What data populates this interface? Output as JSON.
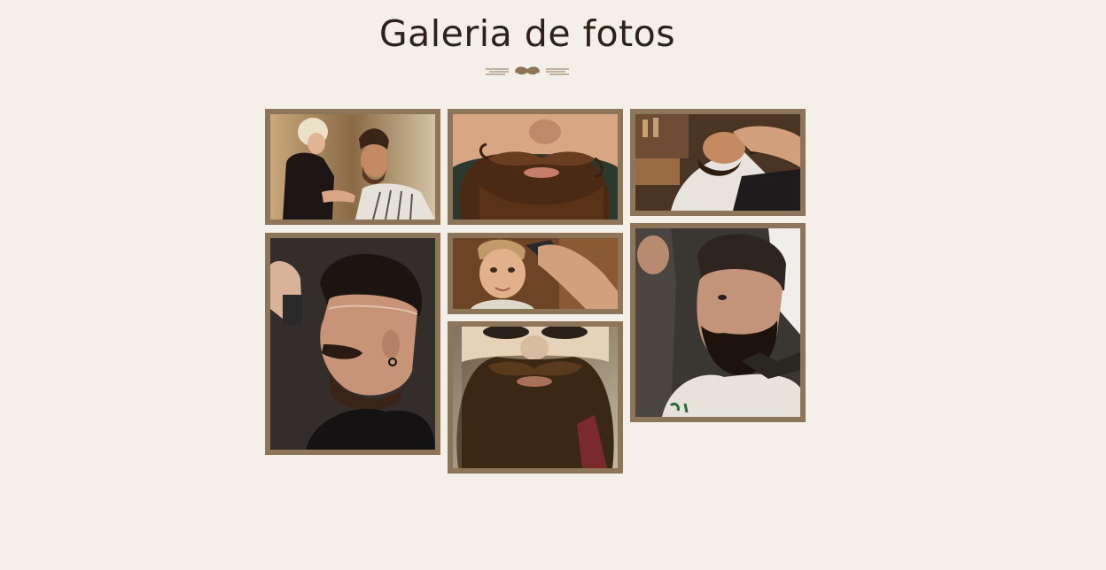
{
  "gallery": {
    "title": "Galeria de fotos",
    "ornament_icon": "mustache-icon",
    "frame_color": "#8c7559",
    "background_color": "#f5efe9",
    "title_color": "#2e2117",
    "photos": [
      {
        "id": "photo-1",
        "subject": "barber-trimming-beard"
      },
      {
        "id": "photo-2",
        "subject": "curled-mustache-closeup"
      },
      {
        "id": "photo-3",
        "subject": "man-reclined-beard-wash"
      },
      {
        "id": "photo-4",
        "subject": "man-undercut-haircut-profile"
      },
      {
        "id": "photo-5",
        "subject": "boy-getting-haircut"
      },
      {
        "id": "photo-6",
        "subject": "man-bearded-portrait"
      },
      {
        "id": "photo-7",
        "subject": "full-beard-sunglasses"
      }
    ]
  }
}
